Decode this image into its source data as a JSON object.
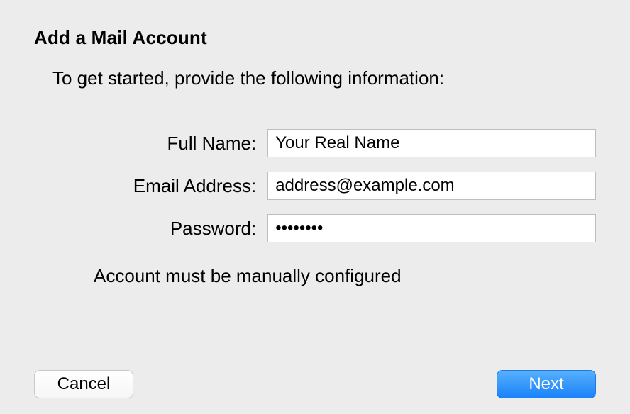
{
  "title": "Add a Mail Account",
  "subtitle": "To get started, provide the following information:",
  "form": {
    "full_name_label": "Full Name:",
    "full_name_value": "Your Real Name",
    "email_label": "Email Address:",
    "email_value": "address@example.com",
    "password_label": "Password:",
    "password_value": "••••••••"
  },
  "status_message": "Account must be manually configured",
  "buttons": {
    "cancel": "Cancel",
    "next": "Next"
  }
}
